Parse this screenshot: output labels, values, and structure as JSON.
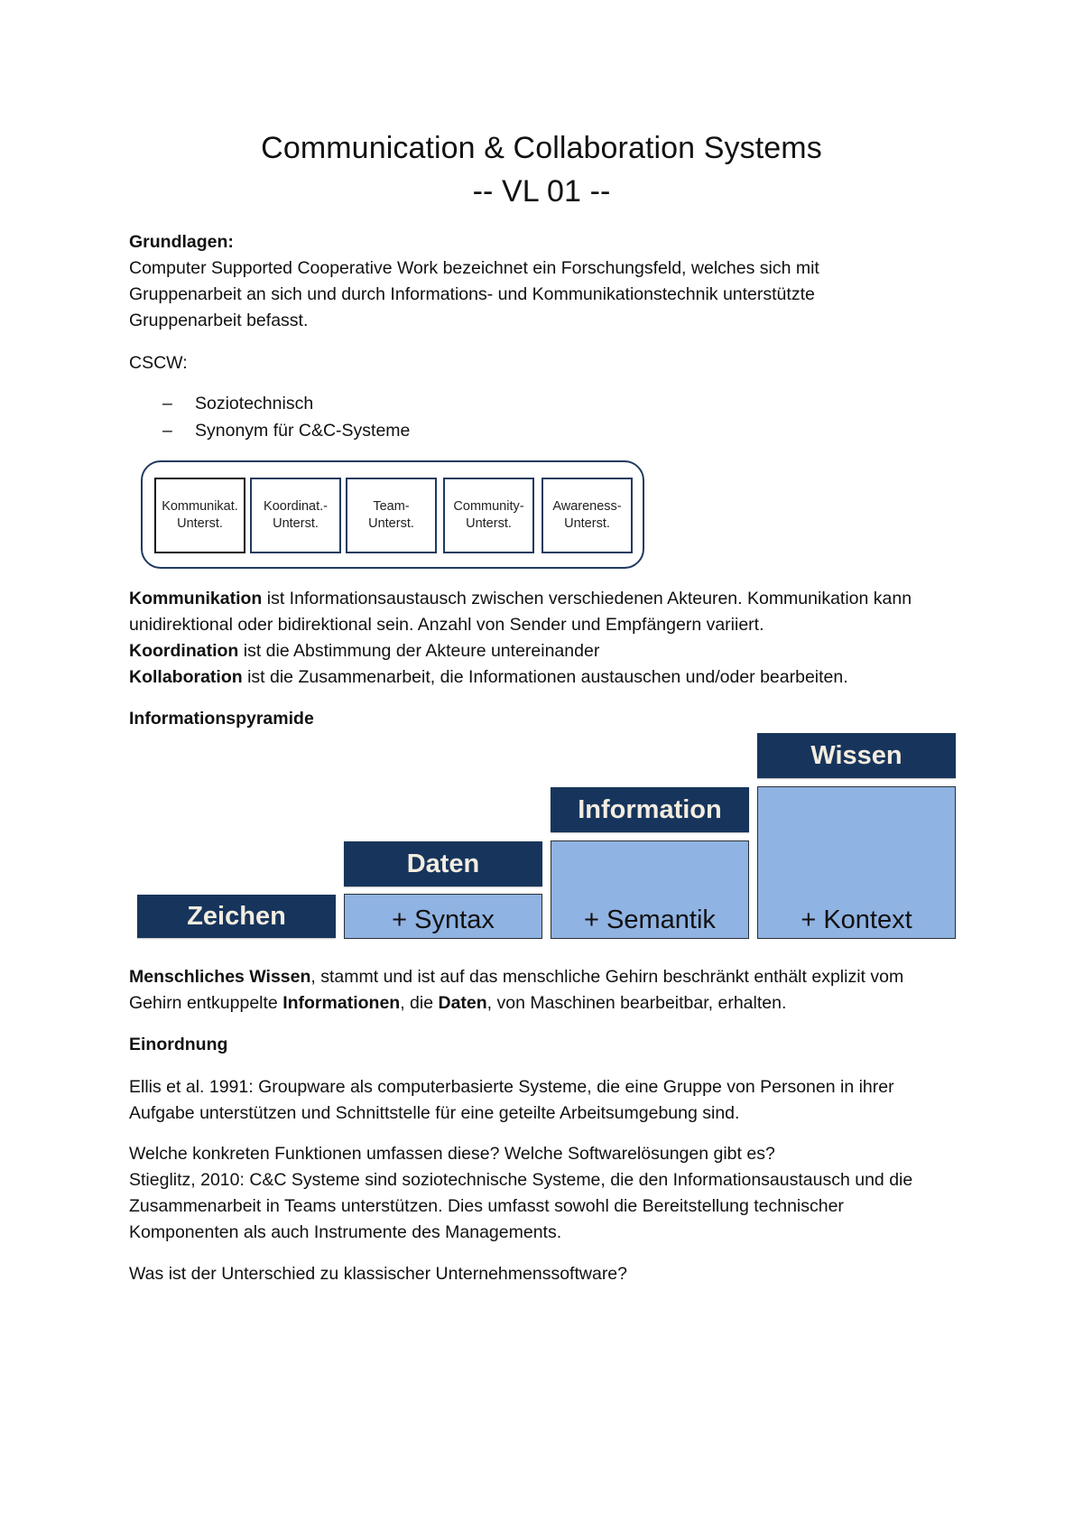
{
  "title": {
    "line1": "Communication & Collaboration Systems",
    "line2": "-- VL 01 --"
  },
  "grundlagen": {
    "heading": "Grundlagen:",
    "lines": [
      "Computer Supported Cooperative Work bezeichnet ein Forschungsfeld, welches sich mit",
      "Gruppenarbeit an sich und durch Informations- und Kommunikationstechnik unterstützte",
      "Gruppenarbeit befasst."
    ]
  },
  "cscw": {
    "label": "CSCW:",
    "bullets": [
      {
        "dash": "–",
        "text": "Soziotechnisch"
      },
      {
        "dash": "–",
        "text": "Synonym für C&C-Systeme"
      }
    ]
  },
  "support_diagram": {
    "boxes": [
      {
        "line1": "Kommunikat.",
        "line2": "Unterst.",
        "highlighted": true
      },
      {
        "line1": "Koordinat.-",
        "line2": "Unterst.",
        "highlighted": false
      },
      {
        "line1": "Team-",
        "line2": "Unterst.",
        "highlighted": false
      },
      {
        "line1": "Community-",
        "line2": "Unterst.",
        "highlighted": false
      },
      {
        "line1": "Awareness-",
        "line2": "Unterst.",
        "highlighted": false
      }
    ],
    "colors": {
      "frame": "#1f3a5f",
      "highlight": "#111111"
    }
  },
  "definitions": {
    "kommunikation": {
      "term": "Kommunikation",
      "rest_line1": " ist Informationsaustausch zwischen verschiedenen Akteuren. Kommunikation kann",
      "line2": "unidirektional oder bidirektional sein. Anzahl von Sender und Empfängern variiert."
    },
    "koordination": {
      "term": "Koordination",
      "rest": " ist die Abstimmung der Akteure untereinander"
    },
    "kollaboration": {
      "term": "Kollaboration",
      "rest": " ist die Zusammenarbeit, die Informationen austauschen und/oder bearbeiten."
    }
  },
  "pyramid": {
    "heading": "Informationspyramide",
    "levels": [
      {
        "name": "Zeichen",
        "addition": ""
      },
      {
        "name": "Daten",
        "addition": "+ Syntax"
      },
      {
        "name": "Information",
        "addition": "+ Semantik"
      },
      {
        "name": "Wissen",
        "addition": "+ Kontext"
      }
    ],
    "colors": {
      "dark": "#17355c",
      "light": "#8fb3e2",
      "dark_text": "#f3ede0"
    }
  },
  "wissen_paragraph": {
    "t1": "Menschliches Wissen",
    "t2": ", stammt und ist auf das menschliche Gehirn beschränkt enthält explizit vom",
    "t3": "Gehirn entkuppelte ",
    "t4": "Informationen",
    "t5": ", die ",
    "t6": "Daten",
    "t7": ", von Maschinen bearbeitbar, erhalten."
  },
  "einordnung": {
    "heading": "Einordnung",
    "ellis": [
      "Ellis et al. 1991: Groupware als computerbasierte Systeme, die eine Gruppe von Personen in ihrer",
      "Aufgabe unterstützen und Schnittstelle für eine geteilte Arbeitsumgebung sind."
    ],
    "question1": "Welche konkreten Funktionen umfassen diese? Welche Softwarelösungen gibt es?",
    "stieglitz": [
      "Stieglitz, 2010: C&C Systeme sind soziotechnische Systeme, die den Informationsaustausch und die",
      "Zusammenarbeit in Teams unterstützen. Dies umfasst sowohl die Bereitstellung technischer",
      "Komponenten als auch Instrumente des Managements."
    ],
    "question2": "Was ist der Unterschied zu klassischer Unternehmenssoftware?"
  }
}
